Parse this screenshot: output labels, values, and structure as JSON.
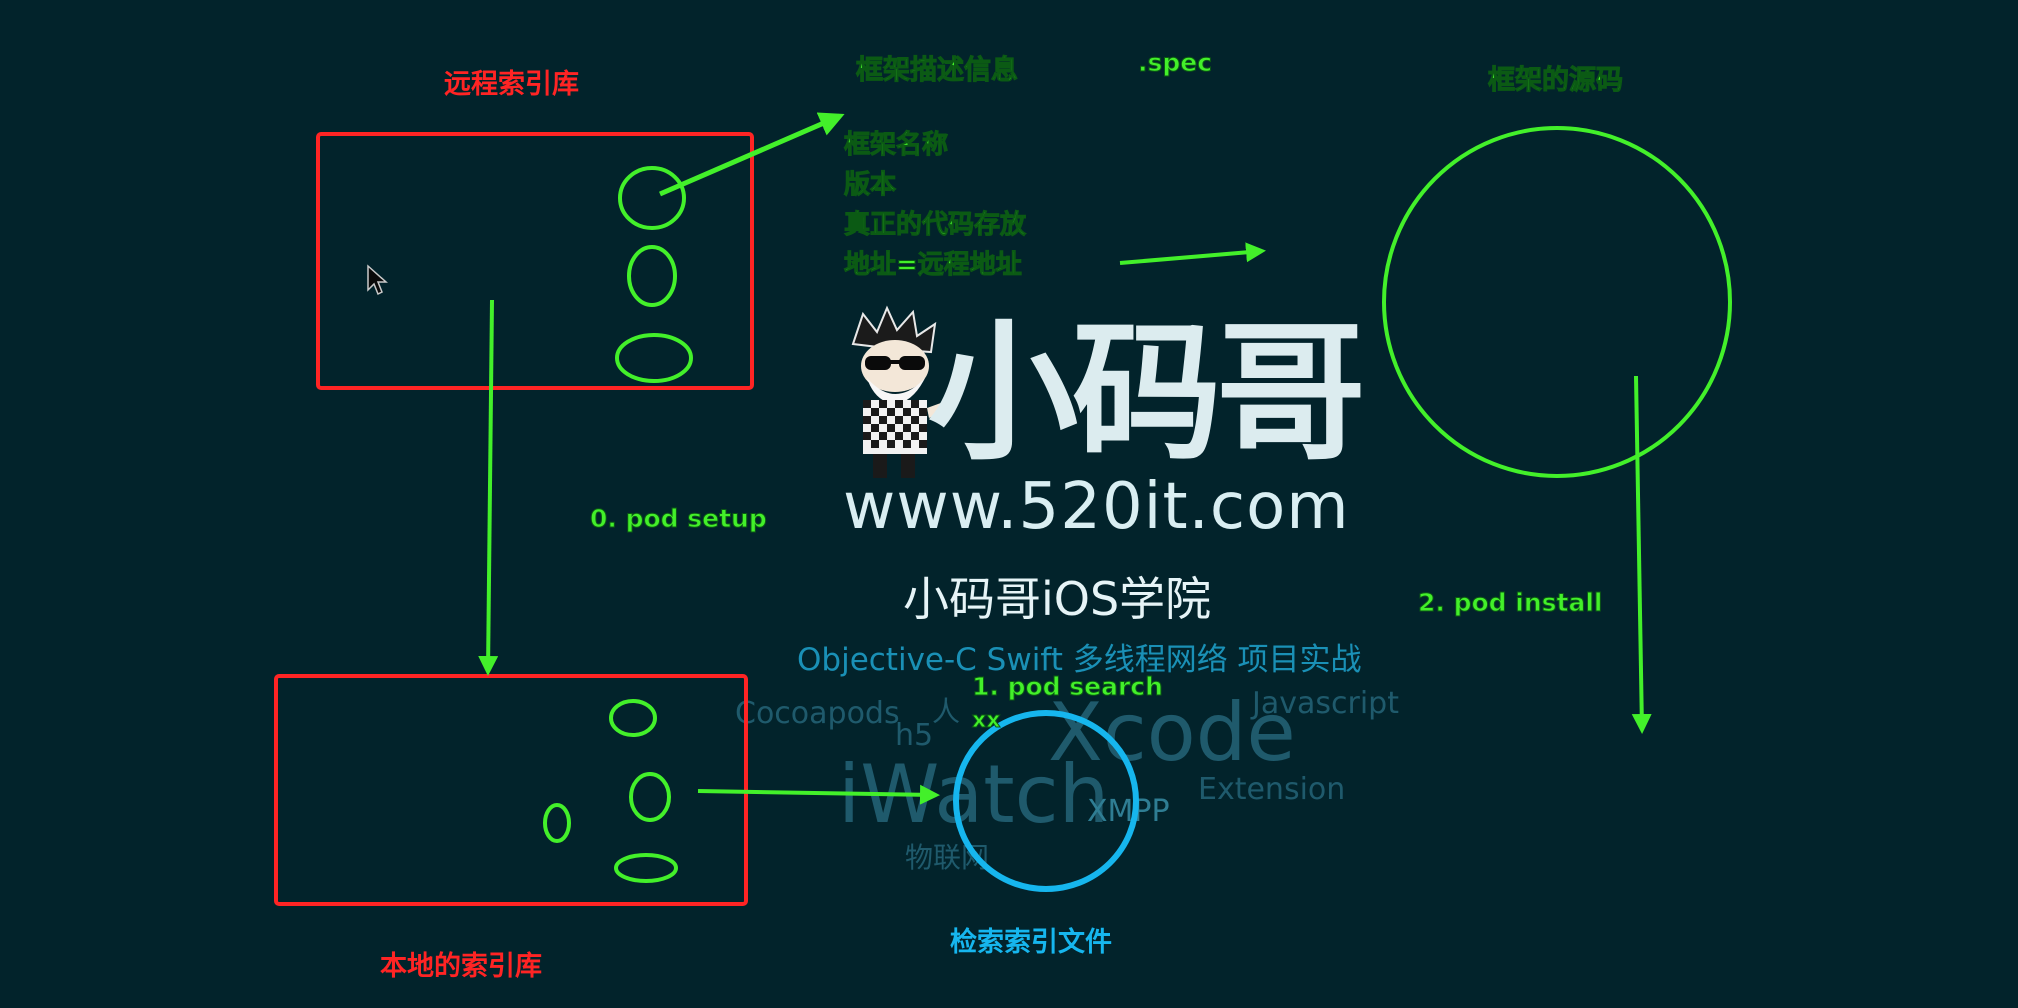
{
  "labels": {
    "remote_index": "远程索引库",
    "framework_info_title": "框架描述信息",
    "spec": ".spec",
    "framework_source": "框架的源码",
    "info_items": [
      "框架名称",
      "版本",
      "真正的代码存放",
      "地址=远程地址"
    ],
    "pod_setup": "0. pod setup",
    "pod_install": "2. pod install",
    "pod_search": "1. pod search",
    "search_arg": "xx",
    "local_index": "本地的索引库",
    "search_index_file": "检索索引文件"
  },
  "watermark": {
    "brand": "小码哥",
    "url": "www.520it.com",
    "school": "小码哥iOS学院",
    "tech_line": "Objective-C  Swift 多线程网络 项目实战",
    "tags": [
      "Cocoapods",
      "h5",
      "Xcode",
      "Javascript",
      "iWatch",
      "XMPP",
      "Extension",
      "物联网",
      "人"
    ]
  },
  "colors": {
    "background": "#02232b",
    "green": "#43f02a",
    "red": "#ff2424",
    "blue": "#16b6ee"
  }
}
